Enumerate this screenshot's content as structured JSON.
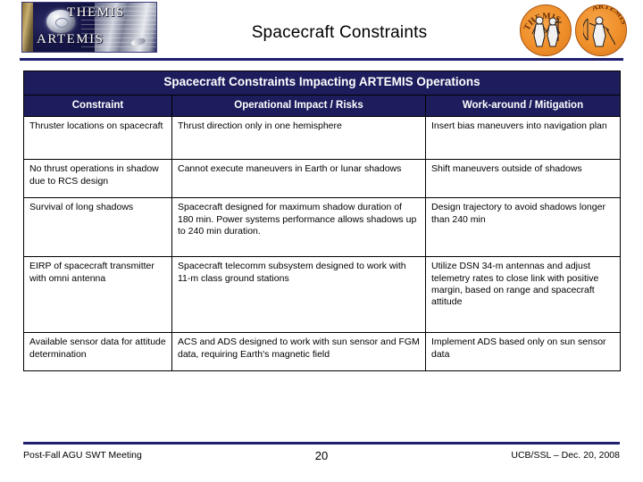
{
  "header": {
    "title": "Spacecraft Constraints",
    "logo": {
      "name": "themis-artemis-logo",
      "line1": "THEMIS",
      "line2": "ARTEMIS"
    },
    "patches": [
      {
        "name": "themis-mission-patch",
        "label": "THEMIS"
      },
      {
        "name": "artemis-mission-patch",
        "label": "ARTEMIS"
      }
    ]
  },
  "table": {
    "banner": "Spacecraft Constraints Impacting ARTEMIS Operations",
    "columns": [
      "Constraint",
      "Operational Impact / Risks",
      "Work-around / Mitigation"
    ],
    "rows": [
      {
        "constraint": "Thruster locations on spacecraft",
        "impact": "Thrust direction only in one hemisphere",
        "mitigation": "Insert bias maneuvers into navigation plan"
      },
      {
        "constraint": "No thrust operations in shadow due to RCS design",
        "impact": "Cannot execute maneuvers in Earth or lunar shadows",
        "mitigation": "Shift maneuvers outside of shadows"
      },
      {
        "constraint": "Survival of long shadows",
        "impact": "Spacecraft designed for maximum shadow duration of 180 min. Power systems performance allows shadows up to 240 min duration.",
        "mitigation": "Design trajectory to avoid shadows longer than 240 min"
      },
      {
        "constraint": "EIRP of spacecraft transmitter with omni antenna",
        "impact": "Spacecraft telecomm subsystem designed to work with 11-m class ground stations",
        "mitigation": "Utilize DSN 34-m antennas and adjust telemetry rates to close link with positive margin, based on range and spacecraft attitude"
      },
      {
        "constraint": "Available sensor data for attitude determination",
        "impact": "ACS and ADS designed to work with sun sensor and FGM data, requiring Earth's magnetic field",
        "mitigation": "Implement ADS based only on sun sensor data"
      }
    ]
  },
  "footer": {
    "left": "Post-Fall AGU SWT Meeting",
    "page_number": "20",
    "right": "UCB/SSL – Dec. 20, 2008"
  },
  "colors": {
    "navy": "#1d1d5e",
    "rule": "#1f1f6e",
    "patch_orange": "#ef8f2a",
    "text": "#000000",
    "header_text": "#ffffff"
  }
}
